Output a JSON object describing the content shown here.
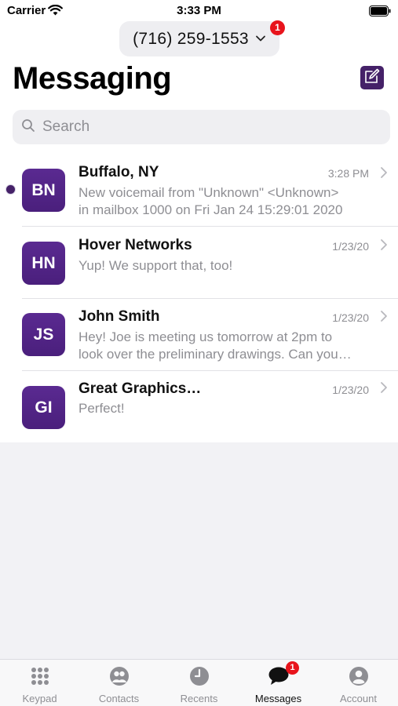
{
  "status_bar": {
    "carrier": "Carrier",
    "time": "3:33 PM"
  },
  "header": {
    "phone_number": "(716) 259-1553",
    "number_badge": "1",
    "title": "Messaging"
  },
  "search": {
    "placeholder": "Search"
  },
  "conversations": [
    {
      "initials": "BN",
      "name": "Buffalo, NY",
      "date": "3:28 PM",
      "preview_line1": "New voicemail from \"Unknown\" <Unknown>",
      "preview_line2": "in mailbox 1000 on Fri Jan 24 15:29:01 2020",
      "unread": true
    },
    {
      "initials": "HN",
      "name": "Hover Networks",
      "date": "1/23/20",
      "preview_line1": "Yup! We support that, too!",
      "preview_line2": "",
      "unread": false
    },
    {
      "initials": "JS",
      "name": "John Smith",
      "date": "1/23/20",
      "preview_line1": "Hey! Joe is meeting us tomorrow at 2pm to",
      "preview_line2": "look over the preliminary drawings. Can you…",
      "unread": false
    },
    {
      "initials": "GI",
      "name": "Great Graphics…",
      "date": "1/23/20",
      "preview_line1": "Perfect!",
      "preview_line2": "",
      "unread": false
    }
  ],
  "tab_bar": {
    "tabs": [
      {
        "label": "Keypad",
        "icon": "keypad-icon"
      },
      {
        "label": "Contacts",
        "icon": "contacts-icon"
      },
      {
        "label": "Recents",
        "icon": "clock-icon"
      },
      {
        "label": "Messages",
        "icon": "chat-bubble-icon",
        "active": true
      },
      {
        "label": "Account",
        "icon": "person-icon"
      }
    ],
    "messages_badge": "1"
  },
  "colors": {
    "brand_purple": "#452168",
    "badge_red": "#e8141c",
    "secondary_text": "#8e8e93"
  }
}
